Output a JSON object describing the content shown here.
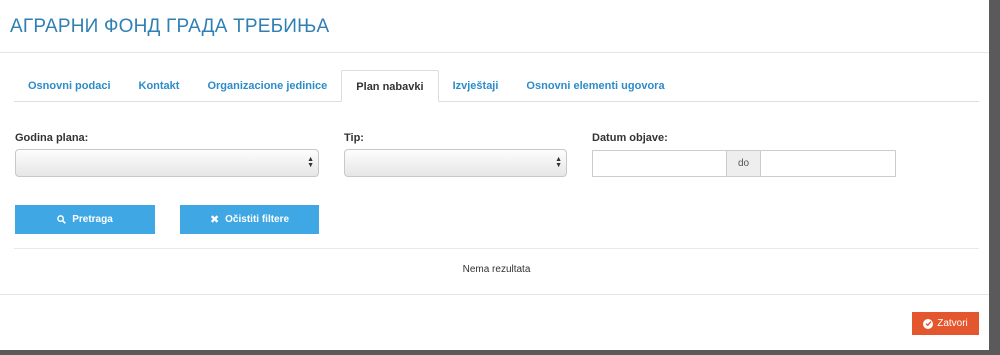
{
  "header": {
    "title": "АГРАРНИ ФОНД ГРАДА ТРЕБИЊА"
  },
  "tabs": [
    {
      "label": "Osnovni podaci",
      "active": false
    },
    {
      "label": "Kontakt",
      "active": false
    },
    {
      "label": "Organizacione jedinice",
      "active": false
    },
    {
      "label": "Plan nabavki",
      "active": true
    },
    {
      "label": "Izvještaji",
      "active": false
    },
    {
      "label": "Osnovni elementi ugovora",
      "active": false
    }
  ],
  "filters": {
    "year_label": "Godina plana:",
    "year_value": "",
    "type_label": "Tip:",
    "type_value": "",
    "date_label": "Datum objave:",
    "date_from": "",
    "date_separator": "do",
    "date_to": ""
  },
  "buttons": {
    "search": "Pretraga",
    "clear": "Očistiti filtere",
    "close": "Zatvori"
  },
  "results": {
    "empty_text": "Nema rezultata"
  },
  "colors": {
    "accent": "#3fa8e4",
    "title": "#2f7fb5",
    "close": "#e4572e"
  },
  "icons": {
    "search": "search-icon",
    "clear": "times-icon",
    "close": "check-circle-icon"
  }
}
